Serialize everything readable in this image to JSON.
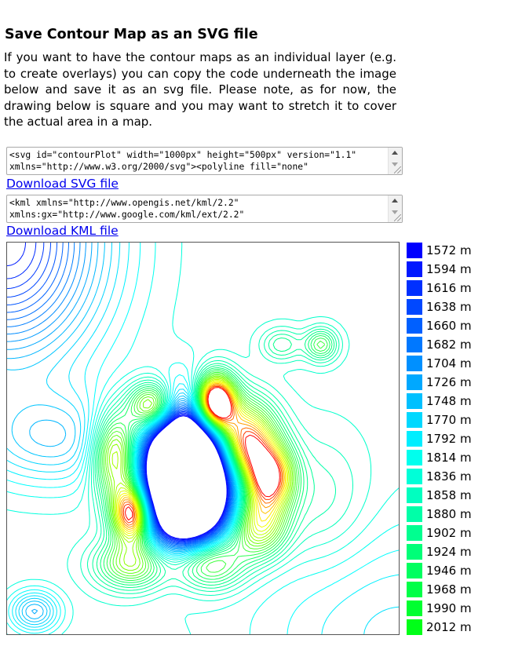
{
  "section": {
    "title": "Save Contour Map as an SVG file",
    "intro": "If you want to have the contour maps as an individual layer (e.g. to create overlays) you can copy the code underneath the image below and save it as an svg file. Please note, as for now, the drawing below is square and you may want to stretch it to cover the actual area in a map."
  },
  "svg_export": {
    "code_line1": "<svg id=\"contourPlot\" width=\"1000px\" height=\"500px\" version=\"1.1\"",
    "code_line2": "xmlns=\"http://www.w3.org/2000/svg\"><polyline fill=\"none\"",
    "download_label": "Download SVG file"
  },
  "kml_export": {
    "code_line1": "<kml xmlns=\"http://www.opengis.net/kml/2.2\"",
    "code_line2": "xmlns:gx=\"http://www.google.com/kml/ext/2.2\"",
    "download_label": "Download KML file"
  },
  "contour_map": {
    "levels": [
      1572,
      1594,
      1616,
      1638,
      1660,
      1682,
      1704,
      1726,
      1748,
      1770,
      1792,
      1814,
      1836,
      1858,
      1880,
      1902,
      1924,
      1946,
      1968,
      1990,
      2012
    ],
    "unit": "m",
    "colors": [
      "#0000ff",
      "#0018ff",
      "#0030ff",
      "#0048ff",
      "#0060ff",
      "#0078ff",
      "#0090ff",
      "#00a8ff",
      "#00c0ff",
      "#00d8ff",
      "#00eeff",
      "#00ffee",
      "#00ffd8",
      "#00ffc0",
      "#00ffa8",
      "#00ff90",
      "#00ff78",
      "#00ff60",
      "#00ff48",
      "#00ff30",
      "#00ff18"
    ],
    "legend": [
      {
        "label": "1572 m"
      },
      {
        "label": "1594 m"
      },
      {
        "label": "1616 m"
      },
      {
        "label": "1638 m"
      },
      {
        "label": "1660 m"
      },
      {
        "label": "1682 m"
      },
      {
        "label": "1704 m"
      },
      {
        "label": "1726 m"
      },
      {
        "label": "1748 m"
      },
      {
        "label": "1770 m"
      },
      {
        "label": "1792 m"
      },
      {
        "label": "1814 m"
      },
      {
        "label": "1836 m"
      },
      {
        "label": "1858 m"
      },
      {
        "label": "1880 m"
      },
      {
        "label": "1902 m"
      },
      {
        "label": "1924 m"
      },
      {
        "label": "1946 m"
      },
      {
        "label": "1968 m"
      },
      {
        "label": "1990 m"
      },
      {
        "label": "2012 m"
      }
    ]
  }
}
